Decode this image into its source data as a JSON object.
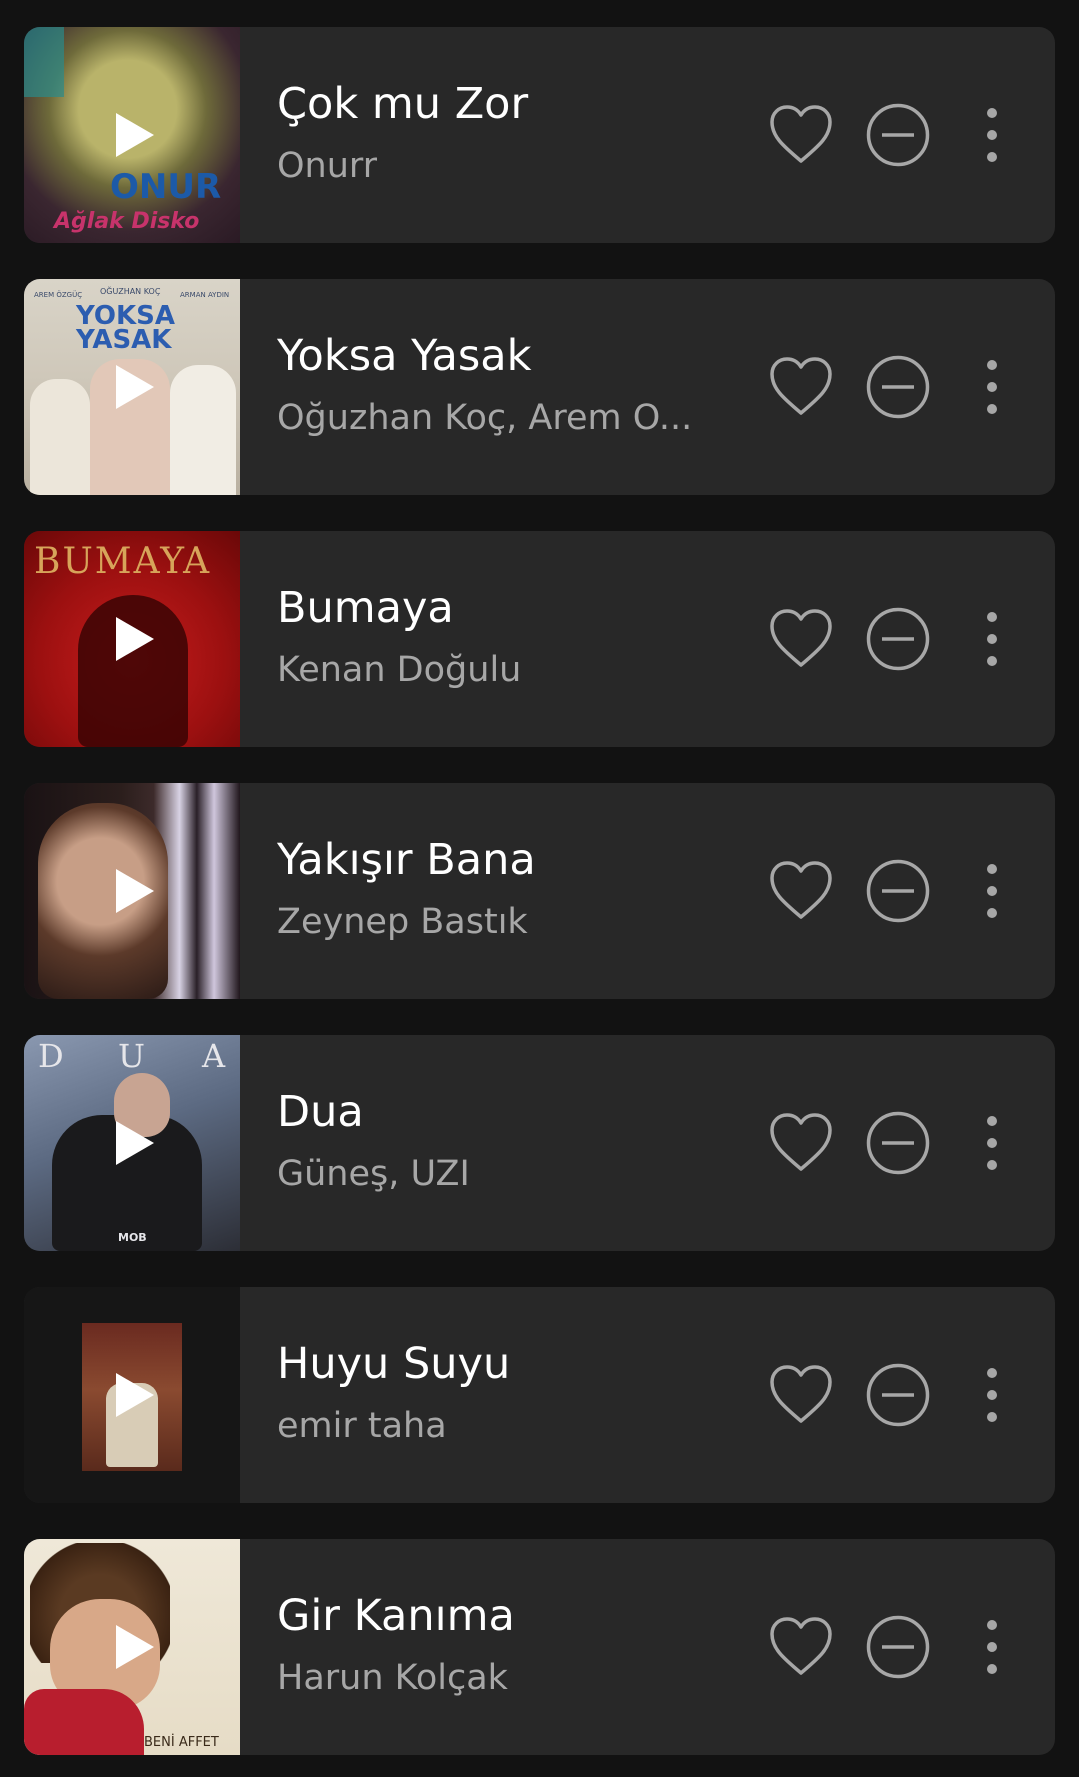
{
  "tracks": [
    {
      "title": "Çok mu Zor",
      "artist": "Onurr",
      "art_texts": [
        "ONUR",
        "Ağlak Disko"
      ]
    },
    {
      "title": "Yoksa Yasak",
      "artist": "Oğuzhan Koç, Arem O...",
      "art_texts": [
        "AREM ÖZGÜÇ",
        "OĞUZHAN KOÇ",
        "ARMAN AYDIN",
        "YOKSA",
        "YASAK"
      ]
    },
    {
      "title": "Bumaya",
      "artist": "Kenan Doğulu",
      "art_texts": [
        "BUMAYA"
      ]
    },
    {
      "title": "Yakışır Bana",
      "artist": "Zeynep Bastık",
      "art_texts": []
    },
    {
      "title": "Dua",
      "artist": "Güneş, UZI",
      "art_texts": [
        "D",
        "U",
        "A",
        "MOB"
      ]
    },
    {
      "title": "Huyu Suyu",
      "artist": "emir taha",
      "art_texts": []
    },
    {
      "title": "Gir Kanıma",
      "artist": "Harun Kolçak",
      "art_texts": [
        "BENİ AFFET"
      ]
    }
  ],
  "icons": {
    "play": "play-icon",
    "like": "heart-icon",
    "hide": "minus-circle-icon",
    "more": "more-vertical-icon"
  },
  "colors": {
    "background": "#121212",
    "card": "#282828",
    "title": "#ffffff",
    "artist": "#a7a7a7",
    "icon": "#a7a7a7"
  }
}
